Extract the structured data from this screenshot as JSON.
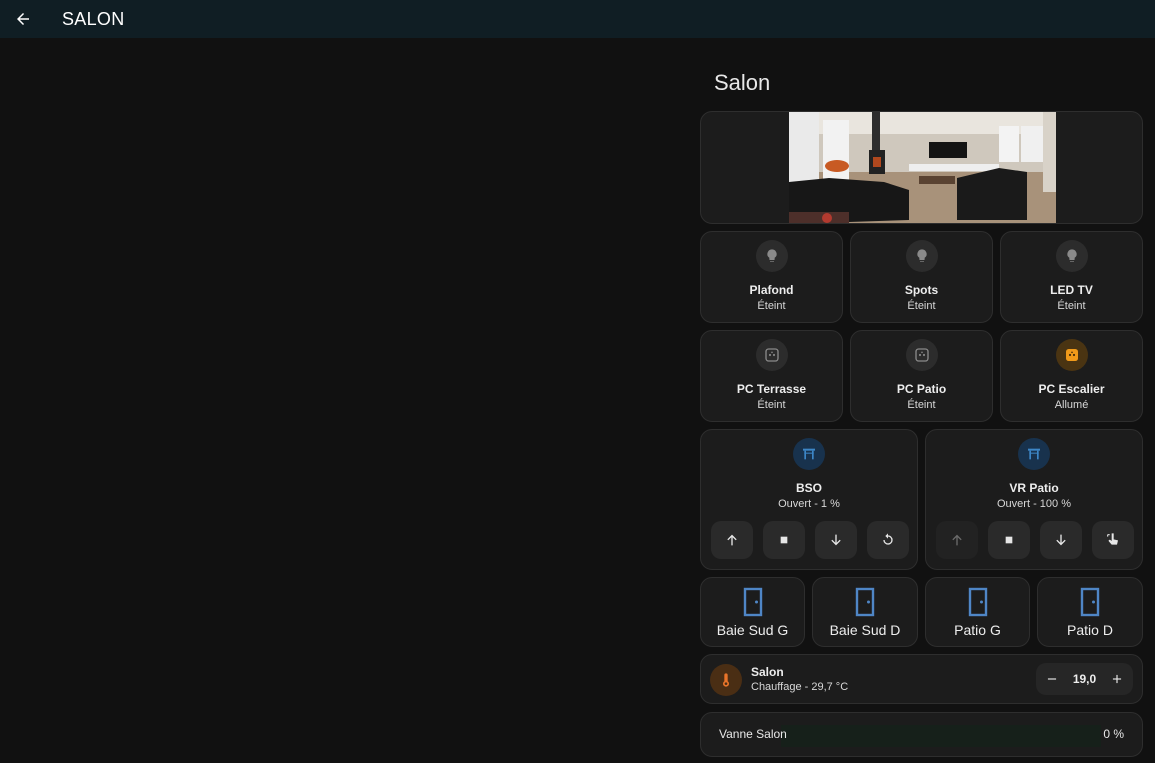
{
  "header": {
    "title": "SALON",
    "back_icon": "arrow-left-icon"
  },
  "section": {
    "title": "Salon"
  },
  "colors": {
    "accent_on": "#f09a1a",
    "cover_blue": "#3d86c6",
    "door_blue": "#4f86c6",
    "thermo_orange": "#e8742a"
  },
  "lights": [
    {
      "name": "Plafond",
      "state": "Éteint",
      "icon": "lightbulb-icon"
    },
    {
      "name": "Spots",
      "state": "Éteint",
      "icon": "lightbulb-icon"
    },
    {
      "name": "LED TV",
      "state": "Éteint",
      "icon": "lightbulb-icon"
    }
  ],
  "sockets": [
    {
      "name": "PC Terrasse",
      "state": "Éteint",
      "icon": "power-socket-icon"
    },
    {
      "name": "PC Patio",
      "state": "Éteint",
      "icon": "power-socket-icon"
    },
    {
      "name": "PC Escalier",
      "state": "Allumé",
      "icon": "power-socket-icon"
    }
  ],
  "covers": [
    {
      "name": "BSO",
      "state": "Ouvert - 1 %",
      "icon": "pergola-icon"
    },
    {
      "name": "VR Patio",
      "state": "Ouvert - 100 %",
      "icon": "pergola-icon"
    }
  ],
  "doors": [
    {
      "name": "Baie Sud G",
      "icon": "door-icon"
    },
    {
      "name": "Baie Sud D",
      "icon": "door-icon"
    },
    {
      "name": "Patio G",
      "icon": "door-icon"
    },
    {
      "name": "Patio D",
      "icon": "door-icon"
    }
  ],
  "thermostat": {
    "name": "Salon",
    "state": "Chauffage - 29,7 °C",
    "setpoint": "19,0",
    "icon": "thermometer-icon"
  },
  "valve": {
    "name": "Vanne Salon",
    "value": "0 %",
    "fraction": 0
  }
}
